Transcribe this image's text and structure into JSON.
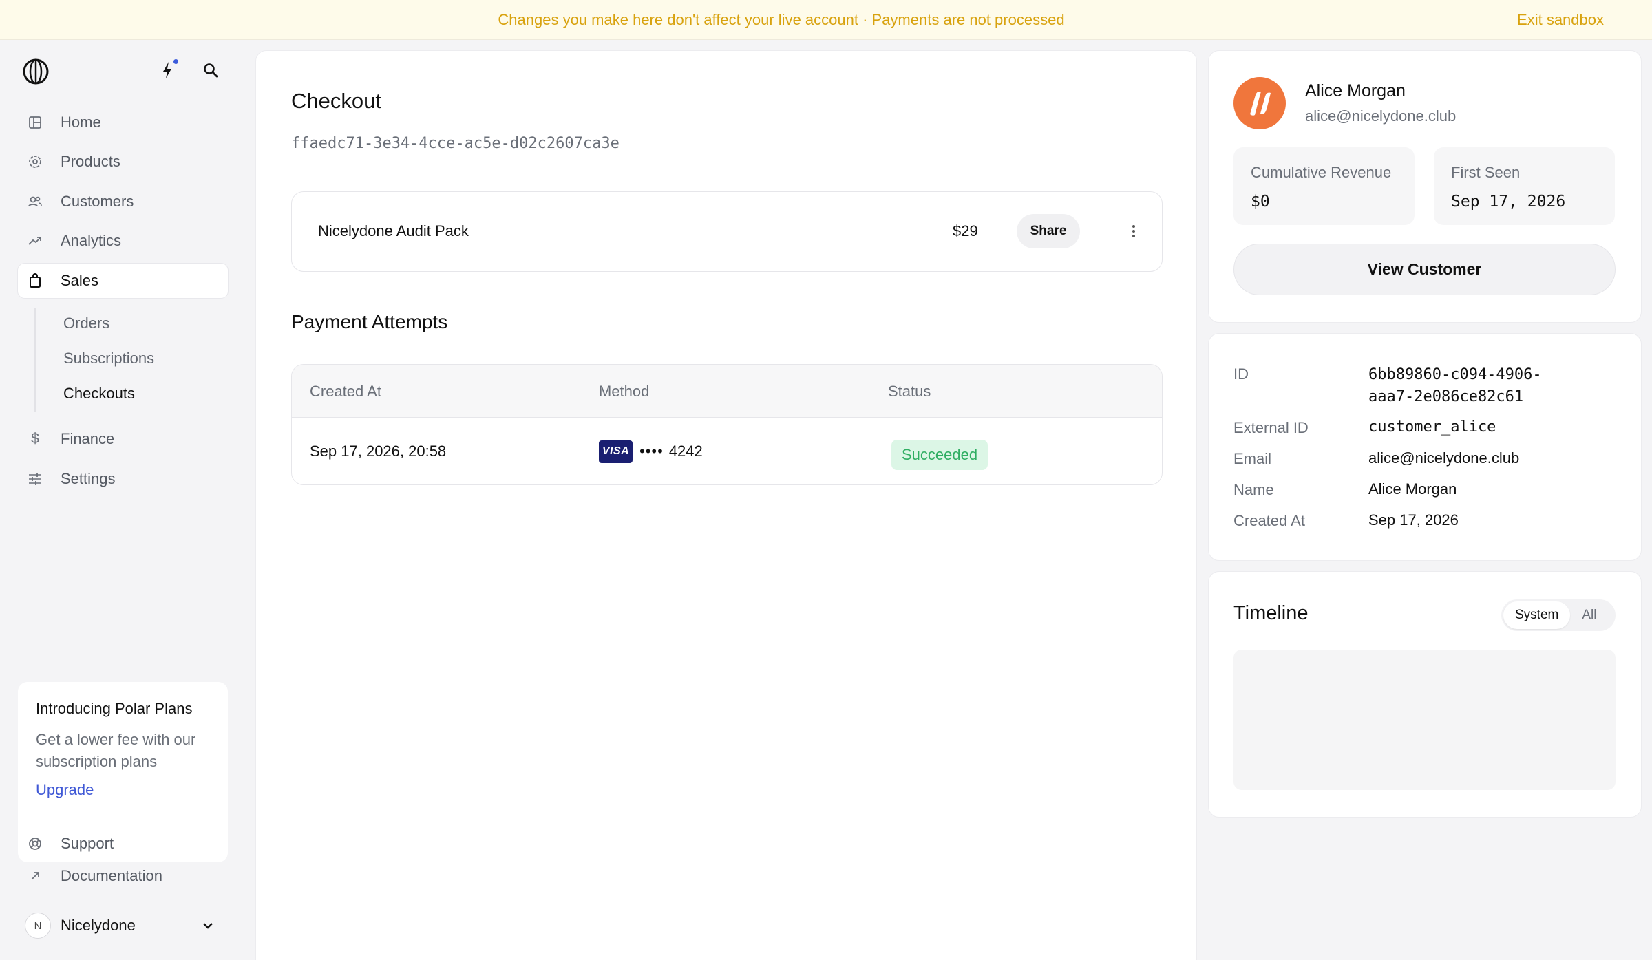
{
  "banner": {
    "message": "Changes you make here don't affect your live account · Payments are not processed",
    "exit_label": "Exit sandbox"
  },
  "colors": {
    "banner_text": "#d8a20e",
    "accent": "#4059d6",
    "success_bg": "#dcf6e6",
    "success_text": "#2fae62",
    "avatar": "#f0763c",
    "visa": "#1a1f71"
  },
  "sidebar": {
    "items": [
      {
        "label": "Home",
        "icon": "home-icon"
      },
      {
        "label": "Products",
        "icon": "products-icon"
      },
      {
        "label": "Customers",
        "icon": "customers-icon"
      },
      {
        "label": "Analytics",
        "icon": "analytics-icon"
      },
      {
        "label": "Sales",
        "icon": "sales-icon",
        "active": true
      },
      {
        "label": "Finance",
        "icon": "dollar-icon"
      },
      {
        "label": "Settings",
        "icon": "settings-icon"
      }
    ],
    "sub_items": [
      {
        "label": "Orders"
      },
      {
        "label": "Subscriptions"
      },
      {
        "label": "Checkouts",
        "active": true
      }
    ],
    "promo": {
      "title": "Introducing Polar Plans",
      "body": "Get a lower fee with our subscription plans",
      "link": "Upgrade"
    },
    "footer": {
      "support": "Support",
      "documentation": "Documentation"
    },
    "org": {
      "initial": "N",
      "name": "Nicelydone"
    }
  },
  "checkout": {
    "title": "Checkout",
    "id": "ffaedc71-3e34-4cce-ac5e-d02c2607ca3e",
    "product": {
      "name": "Nicelydone Audit Pack",
      "price": "$29",
      "share_label": "Share"
    }
  },
  "payments": {
    "title": "Payment Attempts",
    "columns": [
      "Created At",
      "Method",
      "Status"
    ],
    "rows": [
      {
        "created_at": "Sep 17, 2026, 20:58",
        "card_brand": "VISA",
        "card_dots": "••••",
        "card_last4": "4242",
        "status": "Succeeded"
      }
    ]
  },
  "customer": {
    "name": "Alice Morgan",
    "email": "alice@nicelydone.club",
    "stats": [
      {
        "label": "Cumulative Revenue",
        "value": "$0"
      },
      {
        "label": "First Seen",
        "value": "Sep 17, 2026"
      }
    ],
    "view_label": "View Customer",
    "details": [
      {
        "label": "ID",
        "value_line1": "6bb89860-c094-4906-",
        "value_line2": "aaa7-2e086ce82c61"
      },
      {
        "label": "External ID",
        "value": "customer_alice"
      },
      {
        "label": "Email",
        "value": "alice@nicelydone.club"
      },
      {
        "label": "Name",
        "value": "Alice Morgan"
      },
      {
        "label": "Created At",
        "value": "Sep 17, 2026"
      }
    ]
  },
  "timeline": {
    "title": "Timeline",
    "options": [
      "System",
      "All"
    ],
    "selected": "System"
  }
}
